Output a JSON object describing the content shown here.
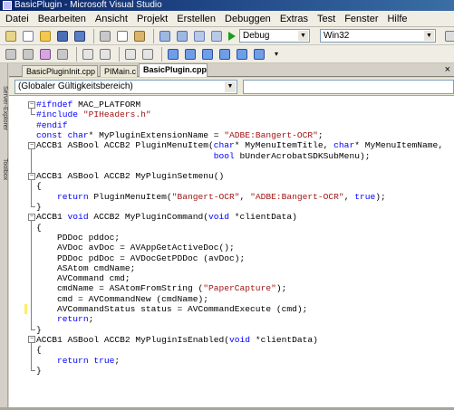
{
  "window": {
    "title": "BasicPlugin - Microsoft Visual Studio"
  },
  "menu": [
    "Datei",
    "Bearbeiten",
    "Ansicht",
    "Projekt",
    "Erstellen",
    "Debuggen",
    "Extras",
    "Test",
    "Fenster",
    "Hilfe"
  ],
  "toolbar": {
    "config_value": "Debug",
    "platform_value": "Win32"
  },
  "side_tabs": [
    "Server-Explorer",
    "Toolbox"
  ],
  "tabs": [
    {
      "label": "BasicPluginInit.cpp",
      "active": false
    },
    {
      "label": "PIMain.c",
      "active": false
    },
    {
      "label": "BasicPlugin.cpp*",
      "active": true
    }
  ],
  "scope": {
    "value": "(Globaler Gültigkeitsbereich)",
    "member_value": ""
  },
  "code": [
    "#ifndef MAC_PLATFORM",
    "#include \"PIHeaders.h\"",
    "#endif",
    "const char* MyPluginExtensionName = \"ADBE:Bangert-OCR\";",
    "ACCB1 ASBool ACCB2 PluginMenuItem(char* MyMenuItemTitle, char* MyMenuItemName,",
    "                                  bool bUnderAcrobatSDKSubMenu);",
    "",
    "ACCB1 ASBool ACCB2 MyPluginSetmenu()",
    "{",
    "    return PluginMenuItem(\"Bangert-OCR\", \"ADBE:Bangert-OCR\", true);",
    "}",
    "ACCB1 void ACCB2 MyPluginCommand(void *clientData)",
    "{",
    "    PDDoc pddoc;",
    "    AVDoc avDoc = AVAppGetActiveDoc();",
    "    PDDoc pdDoc = AVDocGetPDDoc (avDoc);",
    "    ASAtom cmdName;",
    "    AVCommand cmd;",
    "    cmdName = ASAtomFromString (\"PaperCapture\");",
    "    cmd = AVCommandNew (cmdName);",
    "    AVCommandStatus status = AVCommandExecute (cmd);",
    "    return;",
    "}",
    "ACCB1 ASBool ACCB2 MyPluginIsEnabled(void *clientData)",
    "{",
    "    return true;",
    "}"
  ],
  "colors": {
    "keyword": "#0000ff",
    "string": "#a31515",
    "titlebar": "#0a246a",
    "change_bar": "#ffee66"
  }
}
